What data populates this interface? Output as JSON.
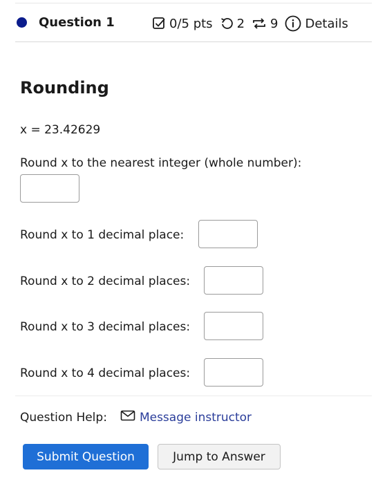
{
  "header": {
    "question_title": "Question 1",
    "points": "0/5 pts",
    "attempts": "2",
    "versions": "9",
    "details_label": "Details"
  },
  "question": {
    "heading": "Rounding",
    "x_value_line": "x = 23.42629",
    "prompts": [
      "Round x to the nearest integer (whole number):",
      "Round x to 1 decimal place:",
      "Round x to 2 decimal places:",
      "Round x to 3 decimal places:",
      "Round x to 4 decimal places:"
    ],
    "answers": [
      "",
      "",
      "",
      "",
      ""
    ]
  },
  "help": {
    "label": "Question Help:",
    "message_link": "Message instructor"
  },
  "actions": {
    "submit_label": "Submit Question",
    "jump_label": "Jump to Answer"
  },
  "colors": {
    "status_dot": "#0b1c8c",
    "primary_button": "#1f6fd6",
    "link": "#2a3d9a"
  },
  "icons": {
    "points": "checkbox-icon",
    "attempts": "undo-icon",
    "versions": "repeat-icon",
    "details": "info-icon",
    "message": "mail-icon"
  }
}
